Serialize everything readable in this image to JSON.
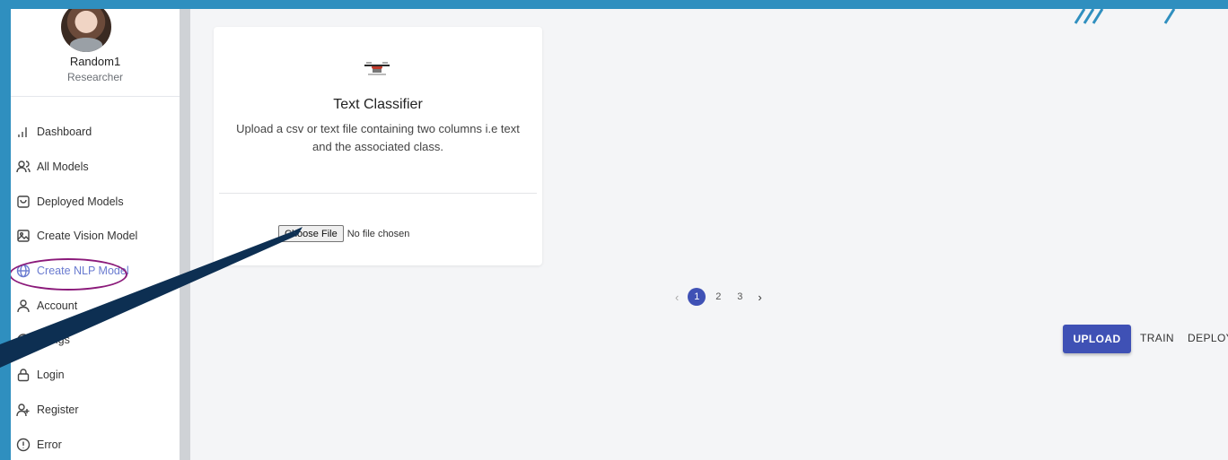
{
  "profile": {
    "name": "Random1",
    "role": "Researcher"
  },
  "nav": {
    "items": [
      {
        "label": "Dashboard",
        "icon": "bar-chart-icon"
      },
      {
        "label": "All Models",
        "icon": "users-icon"
      },
      {
        "label": "Deployed Models",
        "icon": "shopping-bag-icon"
      },
      {
        "label": "Create Vision Model",
        "icon": "image-icon"
      },
      {
        "label": "Create NLP Model",
        "icon": "globe-icon",
        "active": true
      },
      {
        "label": "Account",
        "icon": "user-icon"
      },
      {
        "label": "Settings",
        "icon": "settings-icon",
        "visible_text": "ettings"
      },
      {
        "label": "Login",
        "icon": "lock-icon"
      },
      {
        "label": "Register",
        "icon": "user-plus-icon"
      },
      {
        "label": "Error",
        "icon": "alert-circle-icon"
      }
    ]
  },
  "card": {
    "title": "Text Classifier",
    "description": "Upload a csv or text file containing two columns i.e text and the associated class.",
    "file_button": "Choose File",
    "file_status": "No file chosen"
  },
  "pagination": {
    "pages": [
      "1",
      "2",
      "3"
    ],
    "current": "1"
  },
  "steps": {
    "upload": "UPLOAD",
    "train": "TRAIN",
    "deploy": "DEPLOY"
  },
  "colors": {
    "accent": "#3f51b5",
    "active_nav": "#6a7bd0",
    "annotation": "#8b1a7a",
    "arrow": "#0d2f52"
  }
}
